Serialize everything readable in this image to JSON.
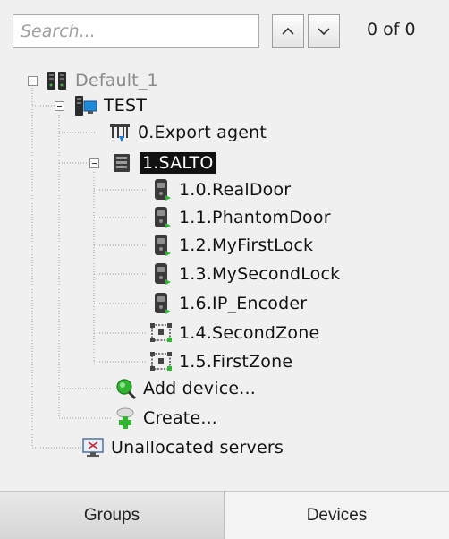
{
  "search": {
    "placeholder": "Search...",
    "value": ""
  },
  "navigation": {
    "up_icon": "chevron-up-icon",
    "down_icon": "chevron-down-icon",
    "counter": "0 of 0"
  },
  "tree": {
    "root": {
      "label": "Default_1",
      "icon": "server-rack-icon"
    },
    "server": {
      "label": "TEST",
      "icon": "computer-server-icon"
    },
    "export_agent": {
      "label": "0.Export agent",
      "icon": "export-agent-icon"
    },
    "salto": {
      "label": "1.SALTO",
      "icon": "controller-icon",
      "selected": true
    },
    "salto_children": [
      {
        "label": "1.0.RealDoor",
        "icon": "door-lock-icon"
      },
      {
        "label": "1.1.PhantomDoor",
        "icon": "door-lock-icon"
      },
      {
        "label": "1.2.MyFirstLock",
        "icon": "door-lock-icon"
      },
      {
        "label": "1.3.MySecondLock",
        "icon": "door-lock-icon"
      },
      {
        "label": "1.6.IP_Encoder",
        "icon": "door-lock-icon"
      },
      {
        "label": "1.4.SecondZone",
        "icon": "zone-icon"
      },
      {
        "label": "1.5.FirstZone",
        "icon": "zone-icon"
      }
    ],
    "add_device": {
      "label": "Add device...",
      "icon": "magnifier-icon"
    },
    "create": {
      "label": "Create...",
      "icon": "create-plus-icon"
    },
    "unallocated": {
      "label": "Unallocated servers",
      "icon": "monitor-icon"
    }
  },
  "tabs": [
    {
      "label": "Groups",
      "active": false
    },
    {
      "label": "Devices",
      "active": true
    }
  ],
  "colors": {
    "selection_bg": "#111111",
    "selection_text": "#ffffff",
    "green_accent": "#2fb52f"
  }
}
